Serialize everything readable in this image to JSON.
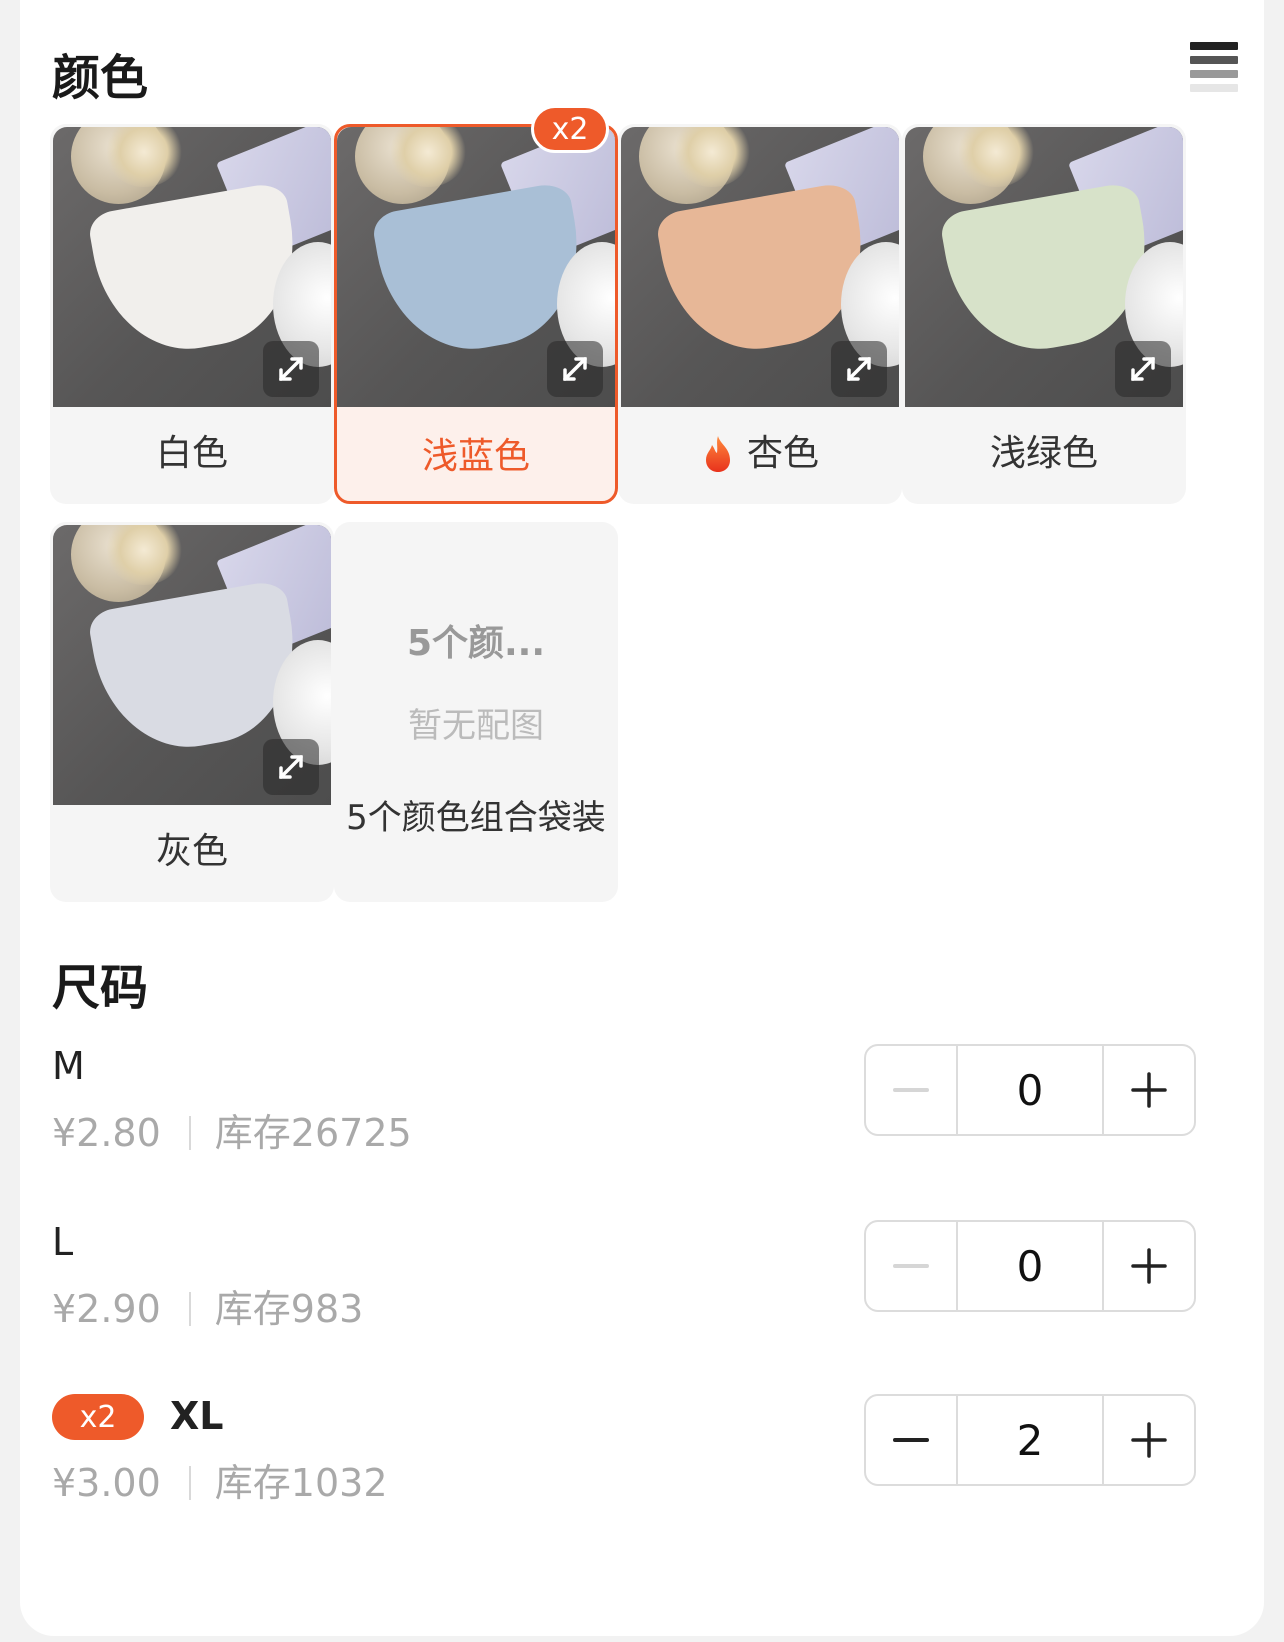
{
  "color_section": {
    "title": "颜色",
    "options": [
      {
        "label": "白色",
        "selected": false,
        "swatch": "#f1efec"
      },
      {
        "label": "浅蓝色",
        "selected": true,
        "badge": "x2",
        "swatch": "#a9bfd6"
      },
      {
        "label": "杏色",
        "selected": false,
        "hot": true,
        "swatch": "#e7b797"
      },
      {
        "label": "浅绿色",
        "selected": false,
        "swatch": "#d7e2c9"
      },
      {
        "label": "灰色",
        "selected": false,
        "swatch": "#d9dbe3"
      },
      {
        "label": "5个颜色组合袋装",
        "selected": false,
        "no_image_title": "5个颜...",
        "no_image_text": "暂无配图"
      }
    ]
  },
  "size_section": {
    "title": "尺码",
    "sizes": [
      {
        "name": "M",
        "price": "¥2.80",
        "stock": "库存26725",
        "quantity": "0"
      },
      {
        "name": "L",
        "price": "¥2.90",
        "stock": "库存983",
        "quantity": "0"
      },
      {
        "name": "XL",
        "price": "¥3.00",
        "stock": "库存1032",
        "quantity": "2",
        "badge": "x2"
      }
    ]
  },
  "colors": {
    "accent": "#ee5a2a",
    "muted_text": "#a9a9a9"
  },
  "icons": {
    "expand": "expand-icon",
    "minus": "minus-icon",
    "plus": "plus-icon",
    "hot": "fire-icon",
    "list": "list-view-icon"
  }
}
